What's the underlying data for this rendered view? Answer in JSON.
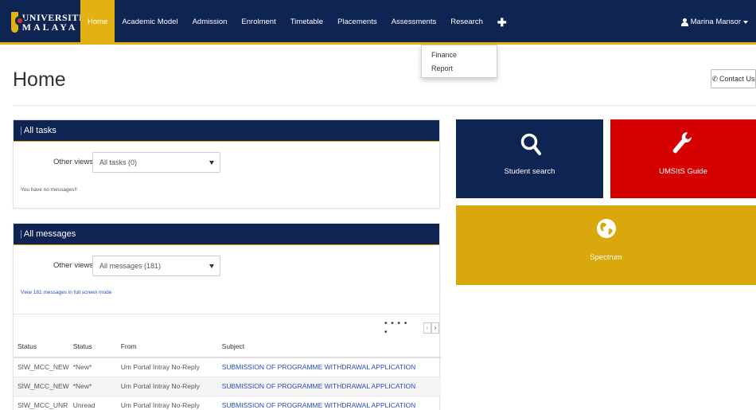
{
  "brand": {
    "line1": "UNIVERSITI",
    "line2": "MALAYA"
  },
  "nav": {
    "items": [
      {
        "label": "Home",
        "active": true
      },
      {
        "label": "Academic Model"
      },
      {
        "label": "Admission"
      },
      {
        "label": "Enrolment"
      },
      {
        "label": "Timetable"
      },
      {
        "label": "Placements"
      },
      {
        "label": "Assessments"
      },
      {
        "label": "Research"
      }
    ],
    "plus_icon": "plus-icon",
    "user": "Marina Mansor"
  },
  "dropdown": {
    "items": [
      "Finance",
      "Report"
    ]
  },
  "page": {
    "title": "Home",
    "contact_label": "Contact Us"
  },
  "tasks_panel": {
    "title": "All tasks",
    "views_label": "Other views:",
    "select_value": "All tasks (0)",
    "empty_message": "You have no messages!!"
  },
  "messages_panel": {
    "title": "All messages",
    "views_label": "Other views:",
    "select_value": "All messages (181)",
    "fullscreen_link": "View 181 messages in full screen mode",
    "pager_dots": "• • • • •",
    "pager_prev": "‹",
    "pager_next": "›",
    "columns": [
      "Status",
      "Status",
      "From",
      "Subject"
    ],
    "rows": [
      [
        "SIW_MCC_NEW",
        "*New*",
        "Um Portal Intray No-Reply",
        "SUBMISSION OF PROGRAMME WITHDRAWAL APPLICATION"
      ],
      [
        "SIW_MCC_NEW",
        "*New*",
        "Um Portal Intray No-Reply",
        "SUBMISSION OF PROGRAMME WITHDRAWAL APPLICATION"
      ],
      [
        "SIW_MCC_UNR",
        "Unread",
        "Um Portal Intray No-Reply",
        "SUBMISSION OF PROGRAMME WITHDRAWAL APPLICATION"
      ]
    ]
  },
  "tiles": {
    "student_search": {
      "label": "Student search",
      "color": "#0e2453"
    },
    "umsits_guide": {
      "label": "UMSItS Guide",
      "color": "#d40000"
    },
    "spectrum": {
      "label": "Spectrum",
      "color": "#d9a80c"
    }
  },
  "colors": {
    "nav_bg": "#0e2453",
    "accent": "#e2b214",
    "link": "#2a4cc5"
  }
}
